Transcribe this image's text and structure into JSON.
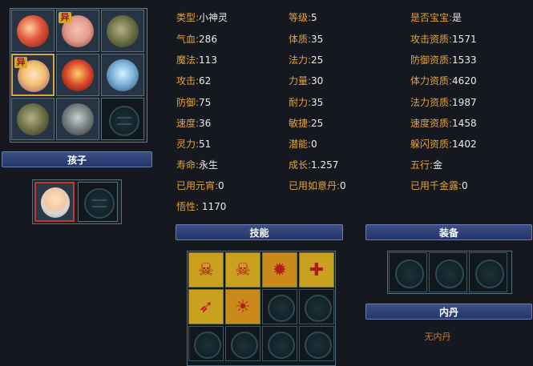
{
  "pets": {
    "cells": [
      {
        "name": "pet-slot-1",
        "badge": "",
        "art": "red-dragon"
      },
      {
        "name": "pet-slot-2",
        "badge": "异",
        "art": "pig-warrior"
      },
      {
        "name": "pet-slot-3",
        "badge": "",
        "art": "rhino"
      },
      {
        "name": "pet-slot-4",
        "badge": "异",
        "art": "spirit-girl",
        "selected": true
      },
      {
        "name": "pet-slot-5",
        "badge": "",
        "art": "red-beast"
      },
      {
        "name": "pet-slot-6",
        "badge": "",
        "art": "blue-rat"
      },
      {
        "name": "pet-slot-7",
        "badge": "",
        "art": "rhino"
      },
      {
        "name": "pet-slot-8",
        "badge": "",
        "art": "wolf"
      },
      {
        "name": "pet-slot-9",
        "badge": "",
        "art": "empty"
      }
    ]
  },
  "child": {
    "header": "孩子",
    "slots": [
      "old-monk-face",
      "empty"
    ]
  },
  "stats": {
    "type_label": "类型:",
    "type": "小神灵",
    "level_label": "等级:",
    "level": "5",
    "baby_label": "是否宝宝:",
    "baby": "是",
    "hp_label": "气血:",
    "hp": "286",
    "physique_label": "体质:",
    "physique": "35",
    "atk_apt_label": "攻击资质:",
    "atk_apt": "1571",
    "mp_label": "魔法:",
    "mp": "113",
    "magic_label": "法力:",
    "magic": "25",
    "def_apt_label": "防御资质:",
    "def_apt": "1533",
    "attack_label": "攻击:",
    "attack": "62",
    "strength_label": "力量:",
    "strength": "30",
    "stamina_apt_label": "体力资质:",
    "stamina_apt": "4620",
    "defense_label": "防御:",
    "defense": "75",
    "endurance_label": "耐力:",
    "endurance": "35",
    "mag_apt_label": "法力资质:",
    "mag_apt": "1987",
    "speed_label": "速度:",
    "speed": "36",
    "agility_label": "敏捷:",
    "agility": "25",
    "spd_apt_label": "速度资质:",
    "spd_apt": "1458",
    "spirit_label": "灵力:",
    "spirit": "51",
    "potential_label": "潜能:",
    "potential": "0",
    "dodge_apt_label": "躲闪资质:",
    "dodge_apt": "1402",
    "life_label": "寿命:",
    "life": "永生",
    "growth_label": "成长:",
    "growth": "1.257",
    "element_label": "五行:",
    "element": "金",
    "yuanxiao_label": "已用元宵:",
    "yuanxiao": "0",
    "ruyi_label": "已用如意丹:",
    "ruyi": "0",
    "qianjin_label": "已用千金露:",
    "qianjin": "0",
    "wisdom_label": "悟性:",
    "wisdom": "1170"
  },
  "skills": {
    "header": "技能",
    "items": [
      {
        "name": "skill-skeleton",
        "glyph": "☠"
      },
      {
        "name": "skill-skull-blade",
        "glyph": "☠"
      },
      {
        "name": "skill-sun-burst",
        "glyph": "✹"
      },
      {
        "name": "skill-plus-stack",
        "glyph": "✚"
      },
      {
        "name": "skill-flame-wing",
        "glyph": "➶"
      },
      {
        "name": "skill-rising-sun",
        "glyph": "☀"
      },
      {
        "name": "skill-empty",
        "glyph": ""
      },
      {
        "name": "skill-empty",
        "glyph": ""
      },
      {
        "name": "skill-empty",
        "glyph": ""
      },
      {
        "name": "skill-empty",
        "glyph": ""
      },
      {
        "name": "skill-empty",
        "glyph": ""
      },
      {
        "name": "skill-empty",
        "glyph": ""
      }
    ]
  },
  "equipment": {
    "header": "装备"
  },
  "neidan": {
    "header": "内丹",
    "empty_text": "无内丹"
  },
  "colors": {
    "label": "#e3a23a",
    "value": "#ececec",
    "header_bg": "#2b3e78",
    "neidan_text": "#d07a2e"
  }
}
